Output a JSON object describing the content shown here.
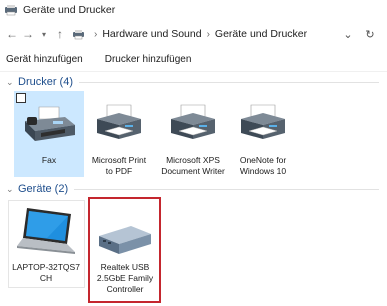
{
  "window": {
    "title": "Geräte und Drucker"
  },
  "addressbar": {
    "crumbs": [
      "Hardware und Sound",
      "Geräte und Drucker"
    ]
  },
  "commandbar": {
    "add_device": "Gerät hinzufügen",
    "add_printer": "Drucker hinzufügen"
  },
  "groups": {
    "printers": {
      "title": "Drucker (4)",
      "items": [
        {
          "label": "Fax",
          "icon": "fax-icon"
        },
        {
          "label_lines": [
            "Microsoft Print",
            "to PDF"
          ],
          "icon": "printer-icon"
        },
        {
          "label_lines": [
            "Microsoft XPS",
            "Document Writer"
          ],
          "icon": "printer-icon"
        },
        {
          "label_lines": [
            "OneNote for",
            "Windows 10"
          ],
          "icon": "printer-icon"
        }
      ]
    },
    "devices": {
      "title": "Geräte (2)",
      "items": [
        {
          "label_lines": [
            "LAPTOP-32TQS7",
            "CH"
          ],
          "icon": "laptop-icon"
        },
        {
          "label_lines": [
            "Realtek USB",
            "2.5GbE Family",
            "Controller"
          ],
          "icon": "network-adapter-icon"
        }
      ]
    }
  },
  "colors": {
    "selected_tile": "#cce8ff",
    "group_title": "#1e4e8c",
    "highlight_border": "#c4262e"
  }
}
